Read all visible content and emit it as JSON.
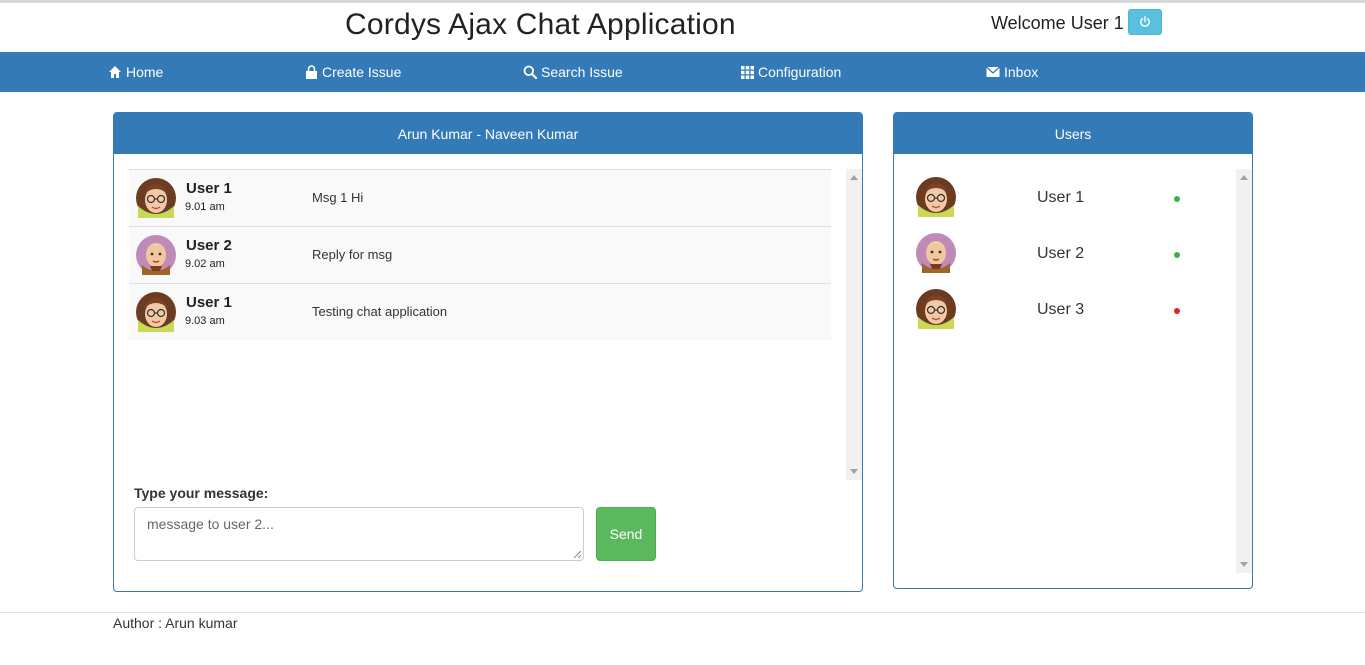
{
  "header": {
    "title": "Cordys Ajax Chat Application",
    "welcome": "Welcome User 1",
    "logout_icon": "power-icon"
  },
  "nav": {
    "items": [
      {
        "label": "Home",
        "icon": "home-icon"
      },
      {
        "label": "Create Issue",
        "icon": "lock-icon"
      },
      {
        "label": "Search Issue",
        "icon": "search-icon"
      },
      {
        "label": "Configuration",
        "icon": "grid-icon"
      },
      {
        "label": "Inbox",
        "icon": "envelope-icon"
      }
    ]
  },
  "chat": {
    "title": "Arun Kumar - Naveen Kumar",
    "messages": [
      {
        "user": "User 1",
        "time": "9.01 am",
        "text": "Msg 1 Hi"
      },
      {
        "user": "User 2",
        "time": "9.02 am",
        "text": "Reply for msg"
      },
      {
        "user": "User 1",
        "time": "9.03 am",
        "text": "Testing chat application"
      }
    ],
    "input_label": "Type your message:",
    "input_placeholder": "message to user 2...",
    "send_label": "Send"
  },
  "users_panel": {
    "title": "Users",
    "users": [
      {
        "name": "User 1",
        "status": "online",
        "status_color": "#3cb043"
      },
      {
        "name": "User 2",
        "status": "online",
        "status_color": "#3cb043"
      },
      {
        "name": "User 3",
        "status": "offline",
        "status_color": "#e0251b"
      }
    ]
  },
  "footer": {
    "author": "Author : Arun kumar"
  },
  "colors": {
    "primary": "#337ab7",
    "info": "#5bc0de",
    "success": "#5cb85c"
  }
}
